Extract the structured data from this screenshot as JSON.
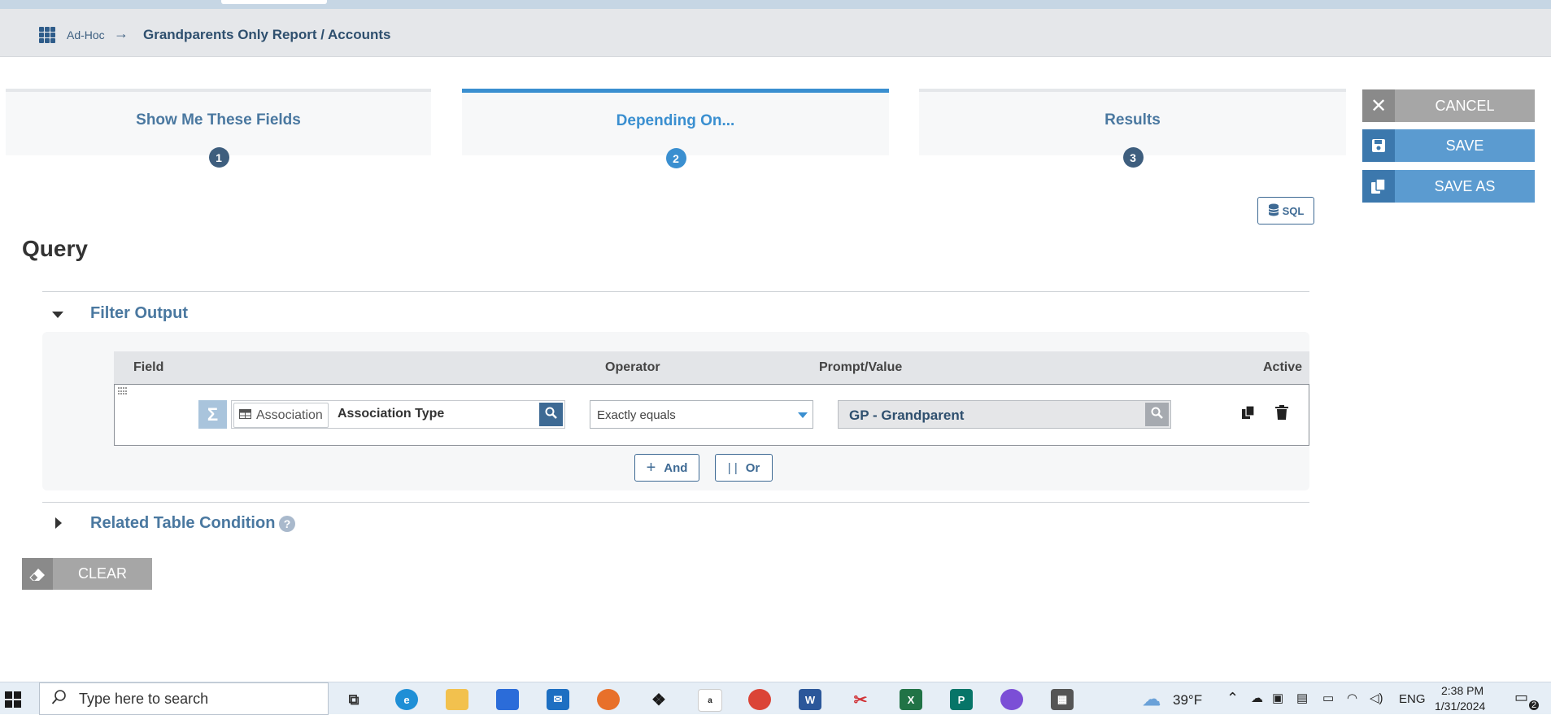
{
  "breadcrumb": {
    "root": "Ad-Hoc",
    "separator": "→",
    "current": "Grandparents Only Report / Accounts"
  },
  "steps": [
    {
      "label": "Show Me These Fields",
      "number": "1",
      "active": false
    },
    {
      "label": "Depending On...",
      "number": "2",
      "active": true
    },
    {
      "label": "Results",
      "number": "3",
      "active": false
    }
  ],
  "actions": {
    "cancel": "CANCEL",
    "save": "SAVE",
    "save_as": "SAVE AS",
    "sql": "SQL",
    "clear": "CLEAR"
  },
  "query": {
    "title": "Query",
    "filter_section_title": "Filter Output",
    "related_section_title": "Related Table Condition",
    "help_glyph": "?",
    "columns": {
      "field": "Field",
      "operator": "Operator",
      "prompt_value": "Prompt/Value",
      "active": "Active"
    },
    "row": {
      "sigma": "Σ",
      "table": "Association",
      "field": "Association Type",
      "operator": "Exactly equals",
      "value": "GP - Grandparent"
    },
    "and_label": "And",
    "or_label": "Or",
    "or_glyph": "| |",
    "and_glyph": "+"
  },
  "taskbar": {
    "search_placeholder": "Type here to search",
    "weather": "39°F",
    "language": "ENG",
    "time": "2:38 PM",
    "date": "1/31/2024",
    "notifications": "2"
  },
  "colors": {
    "accent": "#3a8fd0",
    "primary_dark": "#3e6a94",
    "button_grey": "#a6a6a6",
    "button_blue": "#5b9bd0"
  }
}
